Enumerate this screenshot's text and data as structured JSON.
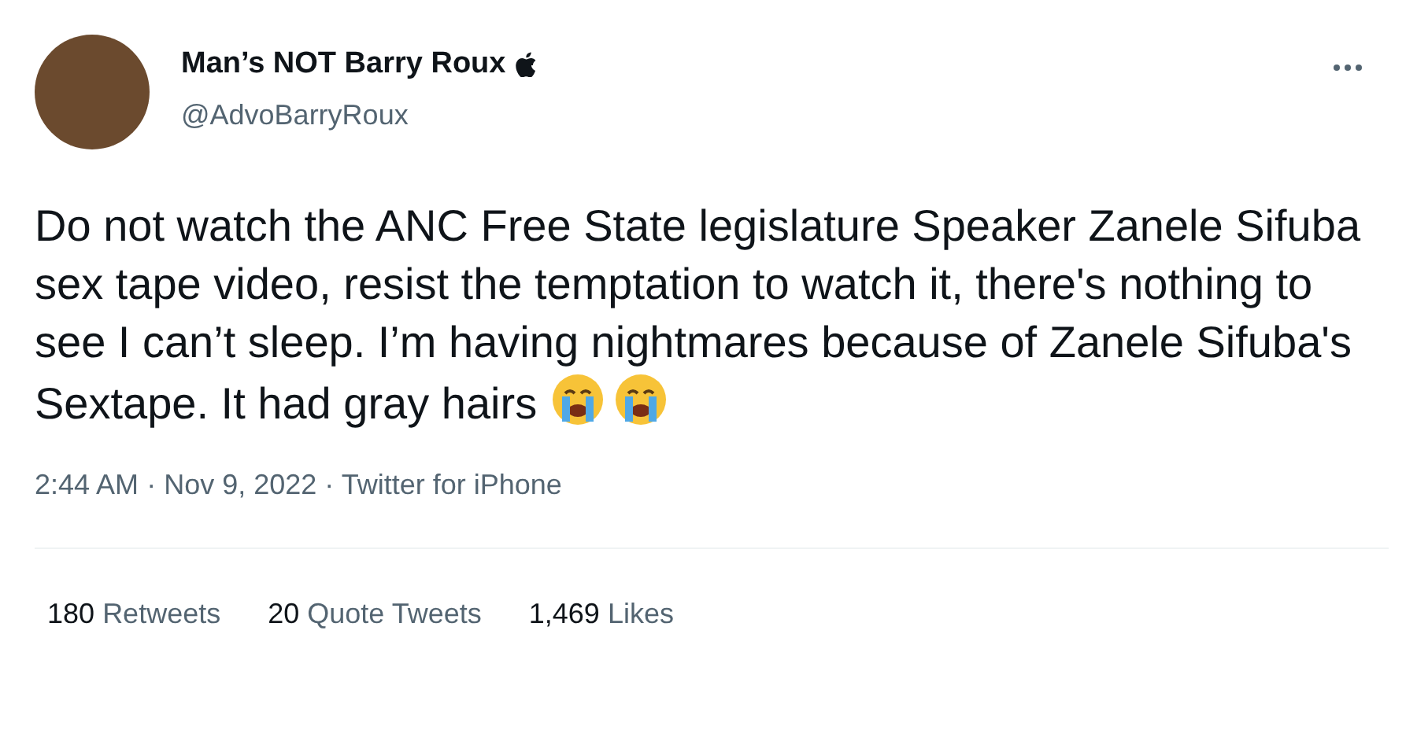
{
  "author": {
    "name": "Man’s NOT Barry Roux",
    "handle": "@AdvoBarryRoux"
  },
  "tweet": {
    "text": "Do not watch the ANC Free State legislature Speaker Zanele Sifuba sex tape video, resist the temptation to watch it, there's nothing to see I can’t sleep. I’m having nightmares because of Zanele Sifuba's Sextape. It had gray hairs",
    "emojis": [
      {
        "kind": "crying"
      },
      {
        "kind": "crying"
      }
    ]
  },
  "meta": {
    "time": "2:44 AM",
    "date": "Nov 9, 2022",
    "source": "Twitter for iPhone",
    "separator": "·"
  },
  "stats": [
    {
      "count": "180",
      "label": "Retweets"
    },
    {
      "count": "20",
      "label": "Quote Tweets"
    },
    {
      "count": "1,469",
      "label": "Likes"
    }
  ]
}
